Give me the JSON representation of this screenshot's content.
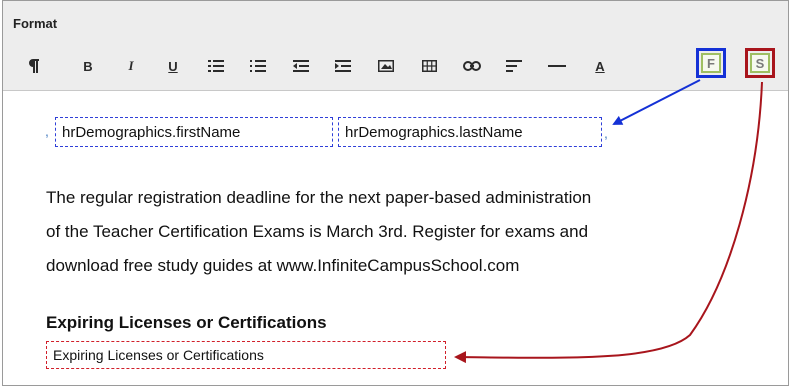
{
  "header": {
    "format_label": "Format"
  },
  "toolbar": {
    "bold": "B",
    "italic": "I",
    "underline": "U",
    "font_color": "A",
    "insert_field": "F",
    "insert_section": "S"
  },
  "content": {
    "fields": {
      "first_name": "hrDemographics.firstName",
      "last_name": "hrDemographics.lastName",
      "section": "Expiring Licenses or Certifications"
    },
    "punct": {
      "lead": ",",
      "trail": ","
    },
    "paragraph_lines": [
      "The regular registration deadline for the next paper-based administration",
      "of the Teacher Certification Exams is March 3rd. Register for exams and",
      "download free study guides at www.InfiniteCampusSchool.com"
    ],
    "heading": "Expiring Licenses or Certifications"
  },
  "colors": {
    "field_highlight": "#1431d6",
    "section_highlight": "#a8151c"
  }
}
